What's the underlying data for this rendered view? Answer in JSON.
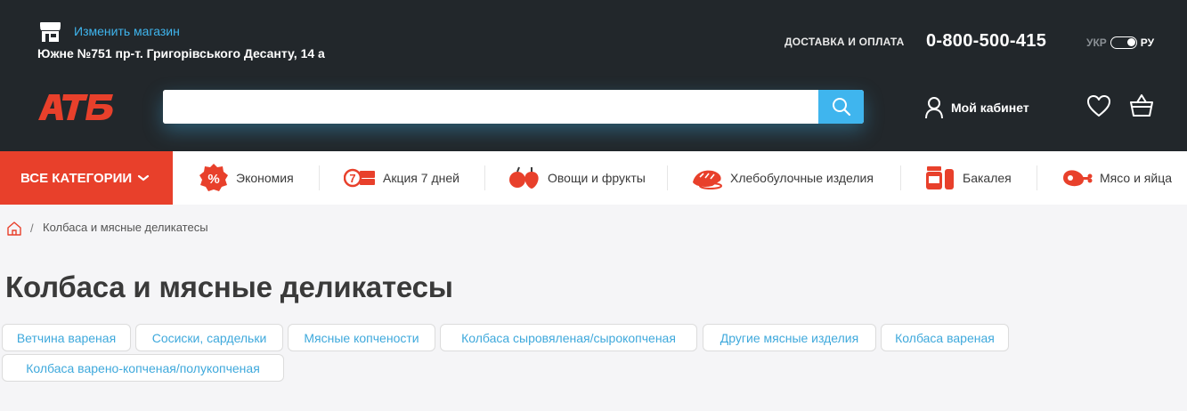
{
  "header": {
    "change_store_label": "Изменить магазин",
    "store_address": "Южне №751 пр-т. Григорівського Десанту, 14 а",
    "delivery_label": "ДОСТАВКА И ОПЛАТА",
    "phone": "0-800-500-415",
    "lang_ukr": "УКР",
    "lang_ru": "РУ",
    "logo_text": "АТБ",
    "search": {
      "placeholder": "",
      "value": ""
    },
    "cabinet_label": "Мой кабинет"
  },
  "nav": {
    "all_categories_label": "ВСЕ КАТЕГОРИИ",
    "categories": [
      {
        "label": "Экономия",
        "icon": "percent-badge-icon"
      },
      {
        "label": "Акция 7 дней",
        "icon": "seven-days-icon"
      },
      {
        "label": "Овощи и фрукты",
        "icon": "apple-icon"
      },
      {
        "label": "Хлебобулочные изделия",
        "icon": "bread-icon"
      },
      {
        "label": "Бакалея",
        "icon": "jar-icon"
      },
      {
        "label": "Мясо и яйца",
        "icon": "meat-icon"
      }
    ]
  },
  "breadcrumb": {
    "separator": "/",
    "current": "Колбаса и мясные деликатесы"
  },
  "page_title": "Колбаса и мясные деликатесы",
  "subcategories": [
    "Ветчина вареная",
    "Сосиски, сардельки",
    "Мясные копчености",
    "Колбаса сыровяленая/сырокопченая",
    "Другие мясные изделия",
    "Колбаса вареная",
    "Колбаса варено-копченая/полукопченая"
  ],
  "colors": {
    "header_bg": "#22272b",
    "brand_red": "#e8402b",
    "accent_blue": "#3fb5ee",
    "chip_text": "#3fa9dc",
    "page_bg": "#f5f5f7"
  }
}
